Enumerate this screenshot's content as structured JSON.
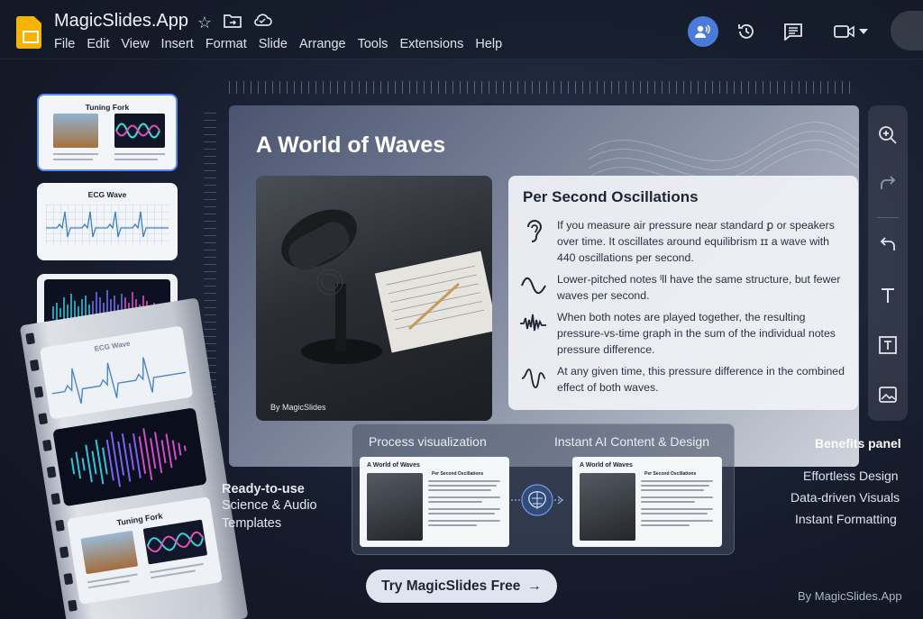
{
  "app": {
    "title": "MagicSlides.App",
    "menu": [
      "File",
      "Edit",
      "View",
      "Insert",
      "Format",
      "Slide",
      "Arrange",
      "Tools",
      "Extensions",
      "Help"
    ],
    "accent": "#4a7bd8"
  },
  "toolbar_icons": [
    "star-icon",
    "folder-move-icon",
    "cloud-icon",
    "share-people-icon",
    "history-icon",
    "comment-icon",
    "video-call-icon",
    "chevron-down-icon"
  ],
  "thumbnails": [
    {
      "title": "Tuning Fork"
    },
    {
      "title": "ECG Wave"
    },
    {
      "title": ""
    }
  ],
  "filmstrip": [
    {
      "title": "ECG Wave"
    },
    {
      "title": ""
    },
    {
      "title": "Tuning Fork"
    }
  ],
  "slide": {
    "title": "A World of Waves",
    "photo_caption": "By MagicSlides",
    "panel_title": "Per Second Oscillations",
    "points": [
      {
        "icon": "ear-icon",
        "text": "If you measure air pressure near standard ꝑ or speakers over time. It oscillates around equilibrism ɪɪ a wave with 440 oscillations per second."
      },
      {
        "icon": "sine-wave-icon",
        "text": "Lower-pitched notes ᴵll have the same structure, but fewer waves per second."
      },
      {
        "icon": "combined-wave-icon",
        "text": "When both notes are played together, the resulting pressure-vs-time graph in the sum of the individual notes pressure difference."
      },
      {
        "icon": "single-wave-icon",
        "text": "At any given time, this pressure difference in the combined effect of both waves."
      }
    ]
  },
  "rail_icons": [
    "zoom-in-icon",
    "redo-icon",
    "undo-icon",
    "text-icon",
    "text-box-icon",
    "image-icon"
  ],
  "process": {
    "left_label": "Process visualization",
    "right_label": "Instant AI Content & Design",
    "mini_title": "A World of Waves",
    "mini_caption": "By MagicSlides",
    "mini_panel_title": "Per Second Oscillations"
  },
  "templates_text": [
    "Ready-to-use",
    "Science & Audio",
    "Templates"
  ],
  "benefits": {
    "title": "Benefits panel",
    "items": [
      "Effortless Design",
      "Data-driven Visuals",
      "Instant Formatting"
    ]
  },
  "cta": {
    "label": "Try MagicSlides Free",
    "arrow": "→"
  },
  "credit": "By MagicSlides.App"
}
